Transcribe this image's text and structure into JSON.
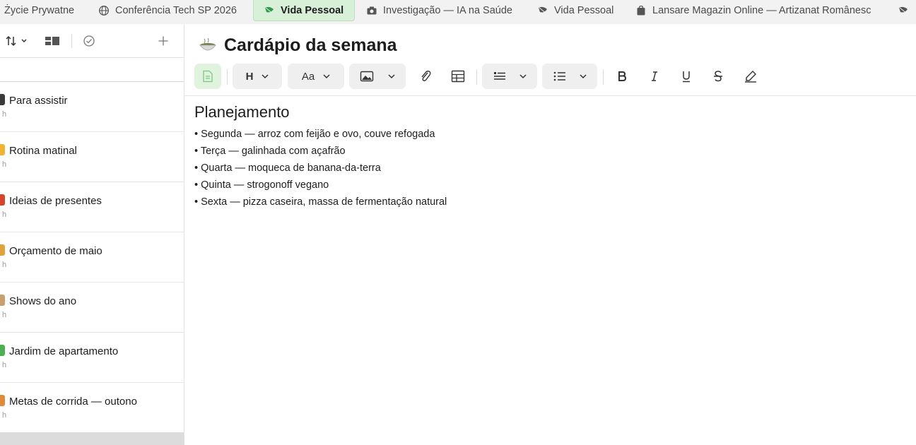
{
  "tabs": [
    {
      "label": "Życie Prywatne",
      "icon": "none"
    },
    {
      "label": "Conferência Tech SP 2026",
      "icon": "globe-icon"
    },
    {
      "label": "Vida Pessoal",
      "icon": "leaf-icon"
    },
    {
      "label": "Investigação — IA na Saúde",
      "icon": "camera-icon"
    },
    {
      "label": "Vida Pessoal",
      "icon": "leaf-icon"
    },
    {
      "label": "Lansare Magazin Online — Artizanat Românesc",
      "icon": "bag-icon"
    },
    {
      "label": "",
      "icon": "leaf-icon"
    }
  ],
  "active_tab_color": "#d7f0d7",
  "sidebar": {
    "toolbar": {
      "sort_icon": "sort-icon",
      "view_icon": "view-toggle-icon",
      "check_icon": "check-circle-icon",
      "add_icon": "plus-icon"
    },
    "notes": [
      {
        "title": "Para assistir",
        "sub": "h",
        "emoji_color": "#3a3a3a"
      },
      {
        "title": "Rotina matinal",
        "sub": "h",
        "emoji_color": "#f2b233"
      },
      {
        "title": "Ideias de presentes",
        "sub": "h",
        "emoji_color": "#d9452b"
      },
      {
        "title": "Orçamento de maio",
        "sub": "h",
        "emoji_color": "#e0a33a"
      },
      {
        "title": "Shows do ano",
        "sub": "h",
        "emoji_color": "#c8a070"
      },
      {
        "title": "Jardim de apartamento",
        "sub": "h",
        "emoji_color": "#4caf50"
      },
      {
        "title": "Metas de corrida — outono",
        "sub": "h",
        "emoji_color": "#e08a3a"
      }
    ]
  },
  "editor": {
    "title": "Cardápio da semana",
    "title_emoji": "bowl-icon",
    "toolbar": {
      "heading": "H",
      "font": "Aa"
    },
    "content": {
      "heading": "Planejamento",
      "lines": [
        "• Segunda — arroz com feijão e ovo, couve refogada",
        "• Terça — galinhada com açafrão",
        "• Quarta — moqueca de banana-da-terra",
        "• Quinta — strogonoff vegano",
        "• Sexta — pizza caseira, massa de fermentação natural"
      ]
    }
  }
}
